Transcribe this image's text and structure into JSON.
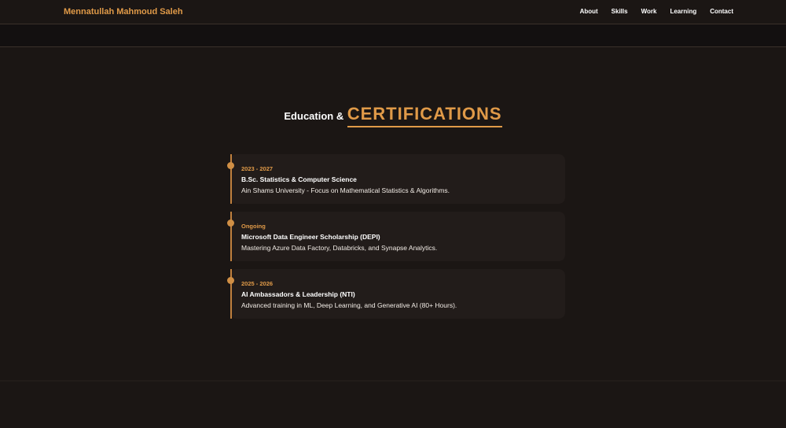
{
  "header": {
    "brand": "Mennatullah Mahmoud Saleh",
    "nav": [
      "About",
      "Skills",
      "Work",
      "Learning",
      "Contact"
    ]
  },
  "section": {
    "title_prefix": "Education &",
    "title_main": "CERTIFICATIONS"
  },
  "timeline": [
    {
      "date": "2023 - 2027",
      "title": "B.Sc. Statistics & Computer Science",
      "desc": "Ain Shams University - Focus on Mathematical Statistics & Algorithms."
    },
    {
      "date": "Ongoing",
      "title": "Microsoft Data Engineer Scholarship (DEPI)",
      "desc": "Mastering Azure Data Factory, Databricks, and Synapse Analytics."
    },
    {
      "date": "2025 - 2026",
      "title": "AI Ambassadors & Leadership (NTI)",
      "desc": "Advanced training in ML, Deep Learning, and Generative AI (80+ Hours)."
    }
  ],
  "colors": {
    "accent": "#e09a48",
    "background": "#1b1614",
    "card": "#221c1a"
  }
}
